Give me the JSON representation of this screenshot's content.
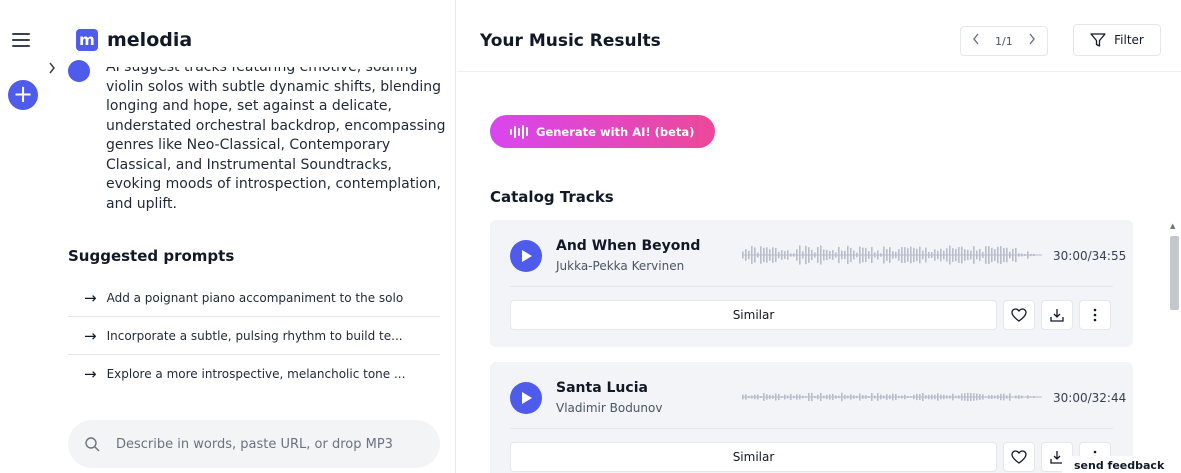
{
  "sidebar": {
    "menu_icon": "hamburger-icon",
    "new_icon": "plus-icon"
  },
  "brand": {
    "logo_letter": "m",
    "name": "melodia"
  },
  "chat": {
    "message": "AI suggest tracks featuring emotive, soaring violin solos with subtle dynamic shifts, blending longing and hope, set against a delicate, understated orchestral backdrop, encompassing genres like Neo-Classical, Contemporary Classical, and Instrumental Soundtracks, evoking moods of introspection, contemplation, and uplift."
  },
  "suggestions": {
    "title": "Suggested prompts",
    "items": [
      "Add a poignant piano accompaniment to the solo",
      "Incorporate a subtle, pulsing rhythm to build te...",
      "Explore a more introspective, melancholic tone ..."
    ]
  },
  "prompt": {
    "placeholder": "Describe in words, paste URL, or drop MP3"
  },
  "results": {
    "title": "Your Music Results",
    "page": "1/1",
    "filter_label": "Filter",
    "generate_label": "Generate with AI! (beta)",
    "catalog_title": "Catalog Tracks"
  },
  "tracks": [
    {
      "title": "And When Beyond",
      "artist": "Jukka-Pekka Kervinen",
      "time": "30:00/34:55",
      "similar_label": "Similar"
    },
    {
      "title": "Santa Lucia",
      "artist": "Vladimir Bodunov",
      "time": "30:00/32:44",
      "similar_label": "Similar"
    }
  ],
  "feedback_label": "send feedback",
  "colors": {
    "accent": "#4f5bea",
    "generate_gradient_start": "#d946ef",
    "generate_gradient_end": "#ec4899",
    "card_bg": "#f3f4f7",
    "waveform": "#b7bdca"
  }
}
